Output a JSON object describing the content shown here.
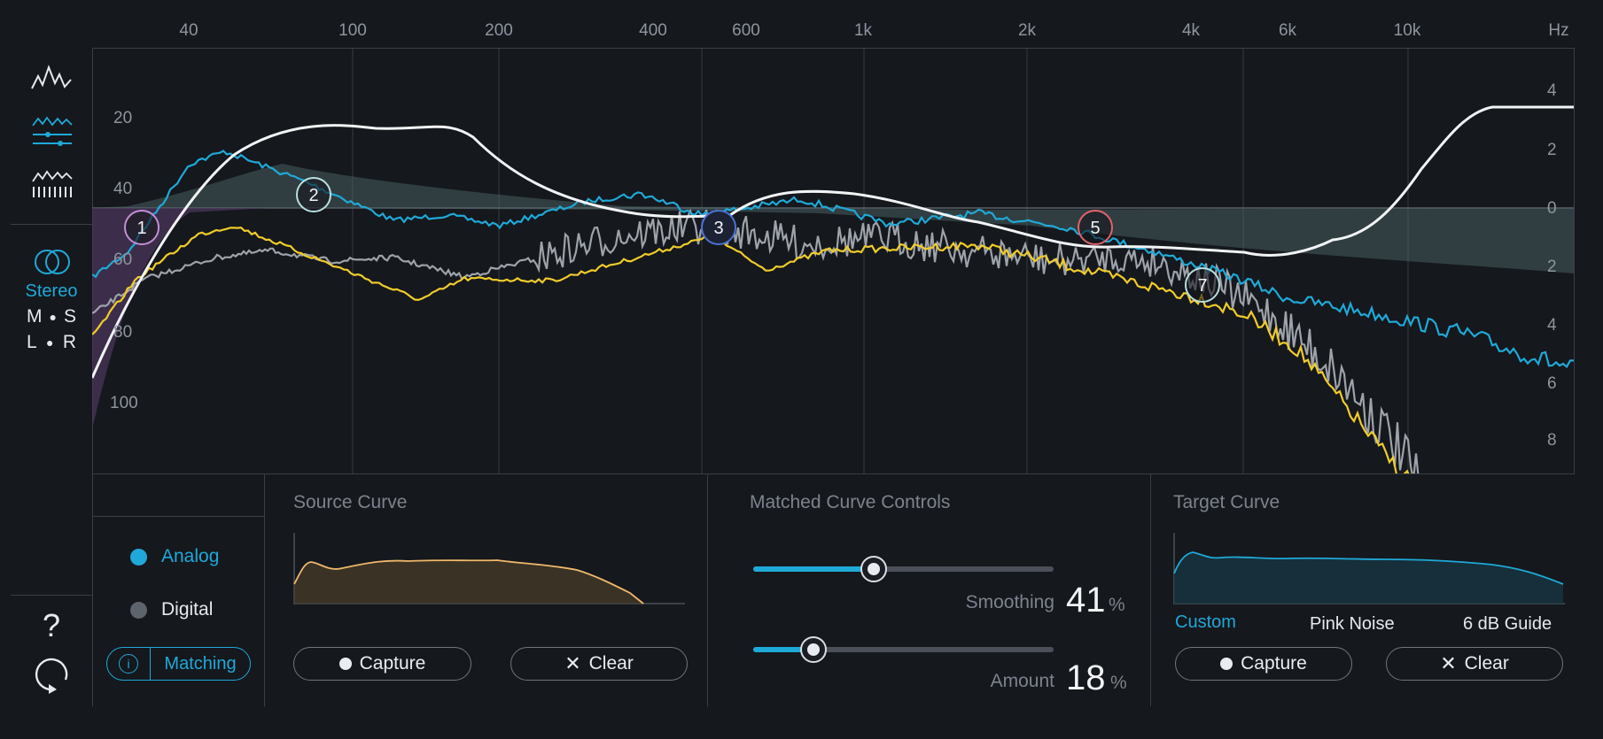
{
  "freq_ruler": {
    "labels": [
      "40",
      "100",
      "200",
      "400",
      "600",
      "1k",
      "2k",
      "4k",
      "6k",
      "10k",
      "Hz"
    ]
  },
  "graph": {
    "left_scale": [
      "20",
      "40",
      "60",
      "80",
      "100"
    ],
    "right_scale": [
      "4",
      "2",
      "0",
      "2",
      "4",
      "6",
      "8"
    ],
    "nodes": [
      {
        "label": "1",
        "color": "#c28fd6"
      },
      {
        "label": "2",
        "color": "#b9dfe0"
      },
      {
        "label": "3",
        "color": "#4c72d6"
      },
      {
        "label": "5",
        "color": "#e0636b"
      },
      {
        "label": "7",
        "color": "#b9dfe0"
      }
    ],
    "colors": {
      "source": "#f0cc2a",
      "target": "#1fa9d8",
      "reference": "#9ea3aa",
      "matched": "#f1f3f5"
    }
  },
  "sidebar": {
    "icons": [
      "spectrum-icon",
      "eq-sliders-icon",
      "waveform-meter-icon",
      "stereo-circles-icon",
      "help-icon",
      "reset-icon"
    ],
    "stereo_label": "Stereo",
    "ms": {
      "left": "M",
      "right": "S"
    },
    "lr": {
      "left": "L",
      "right": "R"
    },
    "help_glyph": "?"
  },
  "mode": {
    "options": [
      {
        "label": "Analog",
        "selected": true
      },
      {
        "label": "Digital",
        "selected": false
      }
    ],
    "matching_label": "Matching",
    "info_glyph": "i"
  },
  "source_curve": {
    "title": "Source Curve",
    "capture_label": "Capture",
    "clear_label": "Clear"
  },
  "matched_controls": {
    "title": "Matched Curve Controls",
    "smoothing": {
      "label": "Smoothing",
      "value": "41",
      "unit": "%",
      "fraction": 0.41
    },
    "amount": {
      "label": "Amount",
      "value": "18",
      "unit": "%",
      "fraction": 0.18
    }
  },
  "target_curve": {
    "title": "Target Curve",
    "options": [
      {
        "label": "Custom",
        "selected": true
      },
      {
        "label": "Pink Noise",
        "selected": false
      },
      {
        "label": "6 dB Guide",
        "selected": false
      }
    ],
    "capture_label": "Capture",
    "clear_label": "Clear"
  }
}
